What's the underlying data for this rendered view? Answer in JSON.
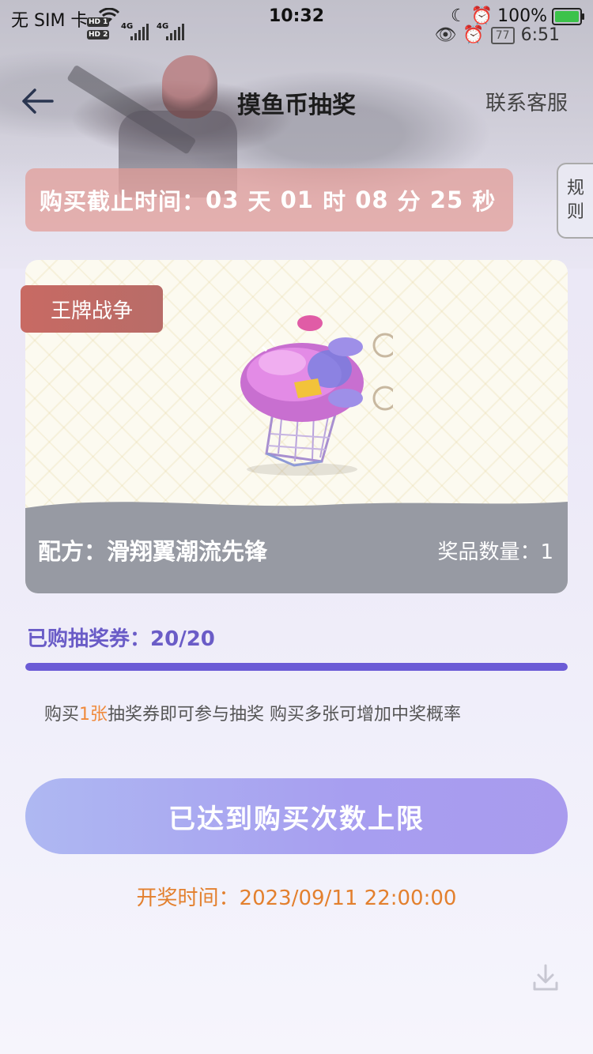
{
  "status_bar": {
    "carrier": "无 SIM 卡",
    "time": "10:32",
    "battery": "100%",
    "secondary_time": "6:51",
    "badge": "77",
    "hd1": "HD 1",
    "hd2": "HD 2",
    "net1": "4G",
    "net2": "4G"
  },
  "nav": {
    "title": "摸鱼币抽奖",
    "service": "联系客服"
  },
  "rules_tab": {
    "line1": "规",
    "line2": "则"
  },
  "deadline": {
    "label": "购买截止时间：",
    "days": "03",
    "days_unit": "天",
    "hours": "01",
    "hours_unit": "时",
    "minutes": "08",
    "minutes_unit": "分",
    "seconds": "25",
    "seconds_unit": "秒"
  },
  "prize_card": {
    "game_tag": "王牌战争",
    "recipe": "配方：滑翔翼潮流先锋",
    "quantity": "奖品数量：1",
    "image_icon": "airship-glider-icon"
  },
  "tickets": {
    "label": "已购抽奖券：",
    "value": "20/20",
    "progress": 1.0
  },
  "hint": {
    "prefix": "购买",
    "number": "1张",
    "suffix": "抽奖券即可参与抽奖 购买多张可增加中奖概率"
  },
  "cta": {
    "label": "已达到购买次数上限"
  },
  "draw_time": {
    "label": "开奖时间：",
    "value": "2023/09/11 22:00:00"
  },
  "colors": {
    "accent": "#6b5bd6",
    "deadline_bg": "#e29b96",
    "tag_bg": "#c86a63",
    "draw_time": "#e3802e",
    "hint_highlight": "#f08a3c"
  }
}
